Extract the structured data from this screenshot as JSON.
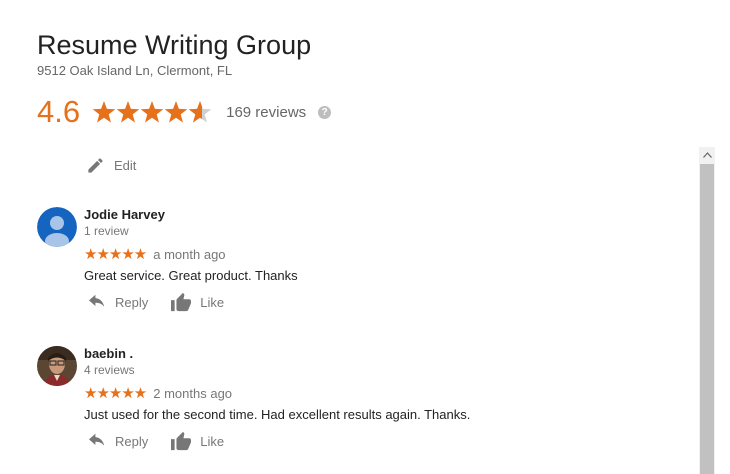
{
  "business": {
    "name": "Resume Writing Group",
    "address": "9512 Oak Island Ln, Clermont, FL",
    "rating": "4.6",
    "rating_value": 4.6,
    "review_count_label": "169 reviews",
    "help_symbol": "?"
  },
  "edit_label": "Edit",
  "colors": {
    "accent": "#e7711b",
    "avatar_blue": "#1565c0"
  },
  "reviews": [
    {
      "name": "Jodie Harvey",
      "count": "1 review",
      "stars": "★★★★★",
      "date": "a month ago",
      "text": "Great service.  Great product.  Thanks",
      "reply_label": "Reply",
      "like_label": "Like",
      "avatar_icon": "default-person-icon"
    },
    {
      "name": "baebin .",
      "count": "4 reviews",
      "stars": "★★★★★",
      "date": "2 months ago",
      "text": "Just used for the second time. Had excellent results again. Thanks.",
      "reply_label": "Reply",
      "like_label": "Like",
      "avatar_icon": "user-photo"
    }
  ]
}
